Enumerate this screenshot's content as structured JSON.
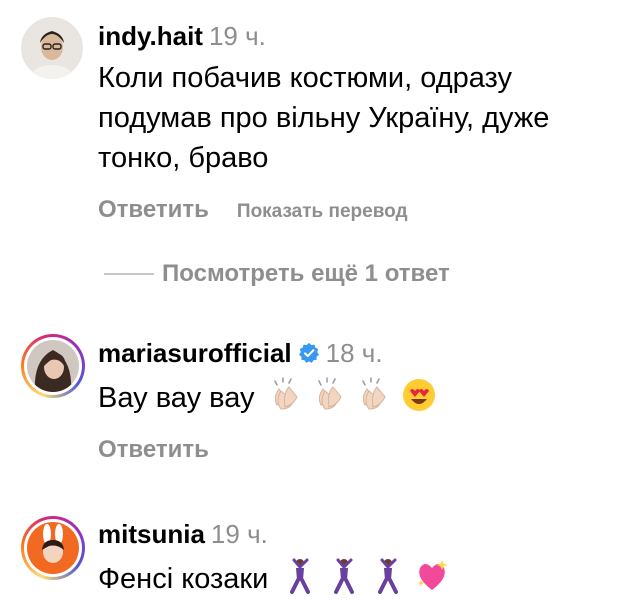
{
  "comments": [
    {
      "username": "indy.hait",
      "time": "19 ч.",
      "text": "Коли побачив костюми, одразу подумав про вільну Україну, дуже тонко, браво",
      "reply_label": "Ответить",
      "translate_label": "Показать перевод"
    },
    {
      "username": "mariasurofficial",
      "time": "18 ч.",
      "verified": true,
      "text": "Вау вау вау",
      "emojis": [
        "clapping-hands",
        "clapping-hands",
        "clapping-hands",
        "heart-eyes-face"
      ],
      "reply_label": "Ответить"
    },
    {
      "username": "mitsunia",
      "time": "19 ч.",
      "text": "Фенсі козаки",
      "emojis": [
        "dancing-man",
        "dancing-man",
        "dancing-man",
        "sparkling-heart"
      ]
    }
  ],
  "view_replies": {
    "label": "Посмотреть ещё 1 ответ"
  },
  "colors": {
    "secondary_text": "#8e8e8e",
    "verified_blue": "#3897f0",
    "divider": "#c7c7c7"
  }
}
